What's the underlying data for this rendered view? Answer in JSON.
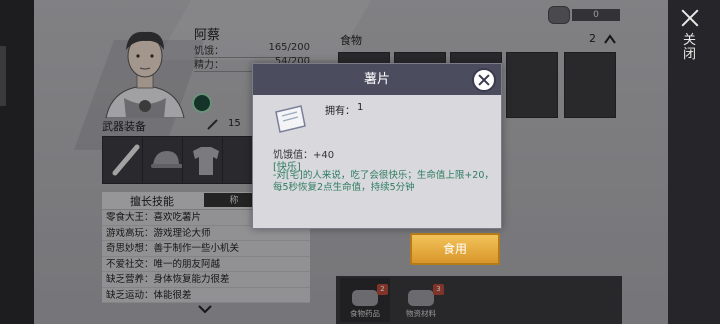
{
  "side": {
    "close_label": "关闭"
  },
  "character": {
    "name": "阿蔡",
    "hunger_label": "饥饿：",
    "hunger_value": "165/200",
    "energy_label": "精力：",
    "energy_value": "54/200"
  },
  "weapons": {
    "title": "武器装备",
    "count": "15"
  },
  "skills": {
    "title": "擅长技能",
    "tab": "称",
    "items": [
      "零食大王：喜欢吃薯片",
      "游戏高玩：游戏理论大师",
      "奇思妙想：善于制作一些小机关",
      "不爱社交：唯一的朋友阿越",
      "缺乏营养：身体恢复能力很差",
      "缺乏运动：体能很差"
    ]
  },
  "food": {
    "title": "食物",
    "count": "2"
  },
  "currency": {
    "value": "0"
  },
  "tabs": [
    {
      "label": "食物药品",
      "badge": "2"
    },
    {
      "label": "物资材料",
      "badge": "3"
    }
  ],
  "use_button": "食用",
  "popup": {
    "title": "薯片",
    "owned_label": "拥有：",
    "owned_value": "1",
    "hunger": "饥饿值：+40",
    "tag": "[快乐]",
    "description": "-对[宅]的人来说，吃了会很快乐；生命值上限+20，每5秒恢复2点生命值，持续5分钟"
  },
  "colors": {
    "popup_header": "#4b4c5e",
    "accent_text": "#2e7d5f",
    "button_gold": "#e0a43a"
  },
  "icons": [
    "close-icon",
    "chevron-up-icon",
    "chevron-down-icon",
    "bat-icon",
    "cap-icon",
    "shirt-icon",
    "chips-icon",
    "food-icon",
    "material-icon",
    "coin-icon",
    "character-mark-icon"
  ]
}
